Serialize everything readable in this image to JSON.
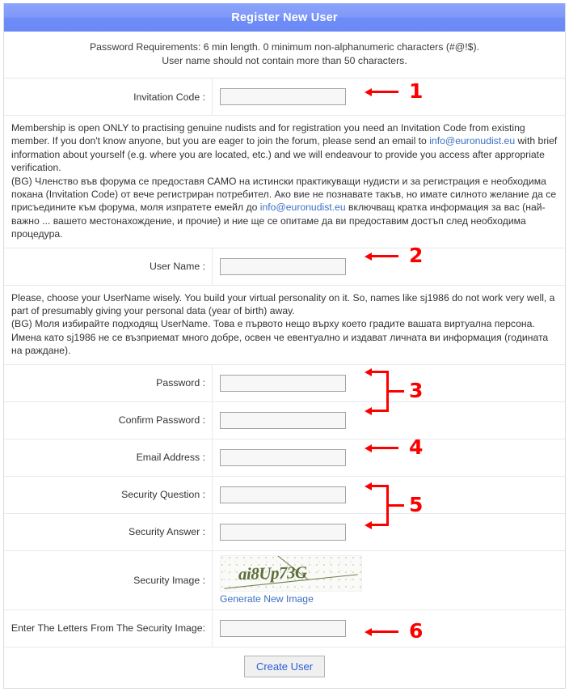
{
  "header": {
    "title": "Register New User"
  },
  "requirements": {
    "line1": "Password Requirements: 6 min length. 0 minimum non-alphanumeric characters (#@!$).",
    "line2": "User name should not contain more than 50 characters."
  },
  "fields": {
    "invitation_code": {
      "label": "Invitation Code :",
      "value": "",
      "placeholder": ""
    },
    "user_name": {
      "label": "User Name :",
      "value": "",
      "placeholder": ""
    },
    "password": {
      "label": "Password :",
      "value": "",
      "placeholder": ""
    },
    "confirm_password": {
      "label": "Confirm Password :",
      "value": "",
      "placeholder": ""
    },
    "email": {
      "label": "Email Address :",
      "value": "",
      "placeholder": ""
    },
    "security_question": {
      "label": "Security Question :",
      "value": "",
      "placeholder": ""
    },
    "security_answer": {
      "label": "Security Answer :",
      "value": "",
      "placeholder": ""
    },
    "security_image": {
      "label": "Security Image :"
    },
    "captcha_entry": {
      "label": "Enter The Letters From The Security Image:",
      "value": "",
      "placeholder": ""
    }
  },
  "invitation_help": {
    "en_part1": "Membership is open ONLY to practising genuine nudists and for registration you need an Invitation Code from existing member. If you don't know anyone, but you are eager to join the forum, please send an email to ",
    "email_link": "info@euronudist.eu",
    "en_part2": " with brief information about yourself (e.g. where you are located, etc.) and we will endeavour to provide you access after appropriate verification.",
    "bg_part1": "(BG) Членство във форума се предоставя САМО на истински практикуващи нудисти и за регистрация е необходима покана (Invitation Code) от вече регистриран потребител. Ако вие не познавате такъв, но имате силното желание да се присъедините към форума, моля изпратете емейл до ",
    "bg_part2": " включващ кратка информация за вас (най-важно ... вашето местонахождение, и прочие) и ние ще се опитаме да ви предоставим достъп след необходима процедура."
  },
  "username_help": {
    "en": "Please, choose your UserName wisely. You build your virtual personality on it. So, names like sj1986 do not work very well, a part of presumably giving your personal data (year of birth) away.",
    "bg": "(BG) Моля избирайте подходящ UserName. Това е първото нещо върху което градите вашата виртуална персона. Имена като sj1986 не се възприемат много добре, освен че евентуално и издават личната ви информация (годината на раждане)."
  },
  "captcha": {
    "text": "ai8Up73G",
    "regenerate_label": "Generate New Image"
  },
  "submit": {
    "label": "Create User"
  },
  "annotations": {
    "n1": "1",
    "n2": "2",
    "n3": "3",
    "n4": "4",
    "n5": "5",
    "n6": "6"
  },
  "colors": {
    "header_blue": "#7a94f8",
    "link_blue": "#3b6fc4",
    "annotation_red": "#fc0000",
    "button_text_blue": "#2a5bd7",
    "captcha_green": "#5e6e3a"
  }
}
